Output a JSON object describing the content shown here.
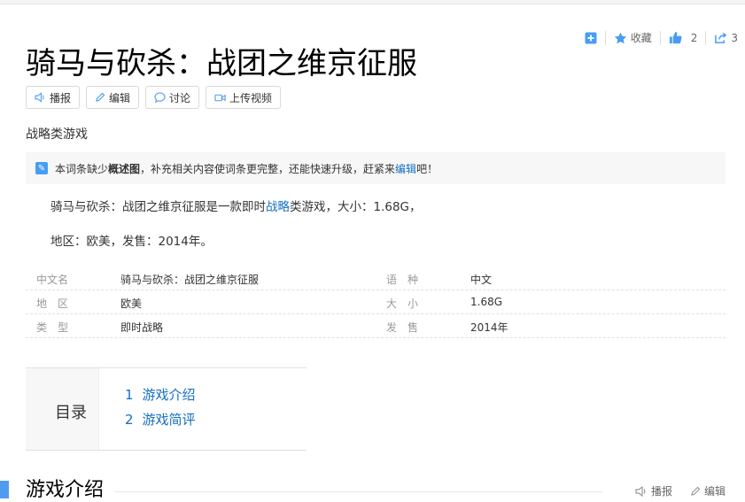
{
  "toolbar": {
    "collect_label": "收藏",
    "like_count": "2",
    "share_count": "3"
  },
  "title": "骑马与砍杀：战团之维京征服",
  "edit_buttons": {
    "play": "播报",
    "edit": "编辑",
    "discuss": "讨论",
    "upload": "上传视频"
  },
  "subtitle": "战略类游戏",
  "notice": {
    "t1": "本词条缺少",
    "b": "概述图",
    "t2": "，补充相关内容使词条更完整，还能快速升级，赶紧来",
    "link": "编辑",
    "t3": "吧！"
  },
  "intro": {
    "p1a": "骑马与砍杀：战团之维京征服是一款即时",
    "p1link": "战略",
    "p1b": "类游戏，大小：1.68G，",
    "p2": "地区：欧美，发售：2014年。"
  },
  "info": {
    "rows": [
      {
        "k1": "中文名",
        "v1": "骑马与砍杀：战团之维京征服",
        "k2": "语　种",
        "v2": "中文"
      },
      {
        "k1": "地　区",
        "v1": "欧美",
        "k2": "大　小",
        "v2": "1.68G"
      },
      {
        "k1": "类　型",
        "v1": "即时战略",
        "k2": "发　售",
        "v2": "2014年"
      }
    ]
  },
  "toc": {
    "label": "目录",
    "items": [
      {
        "num": "1",
        "text": "游戏介绍"
      },
      {
        "num": "2",
        "text": "游戏简评"
      }
    ]
  },
  "section": {
    "title": "游戏介绍",
    "play": "播报",
    "edit": "编辑"
  },
  "colors": {
    "link": "#136ec2",
    "accent": "#4f9cee"
  }
}
